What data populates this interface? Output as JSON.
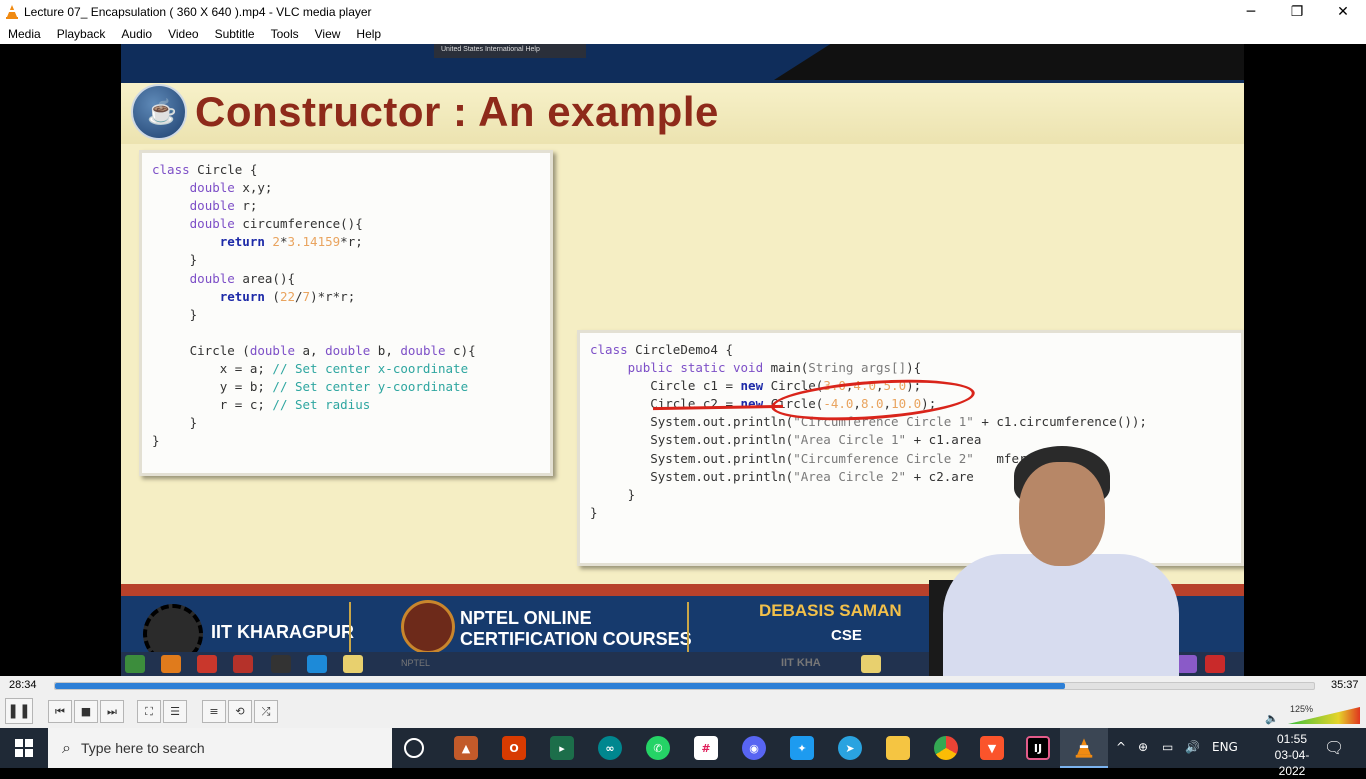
{
  "window": {
    "title": "Lecture 07_ Encapsulation ( 360 X 640 ).mp4 - VLC media player",
    "minimize_icon": "minimize-icon",
    "maximize_icon": "restore-icon",
    "close_icon": "close-icon"
  },
  "menu": [
    "Media",
    "Playback",
    "Audio",
    "Video",
    "Subtitle",
    "Tools",
    "View",
    "Help"
  ],
  "slide": {
    "title": "Constructor : An example",
    "top_tab_text": "United States International  Help",
    "code_left": [
      "class Circle {",
      "     double x,y;",
      "     double r;",
      "     double circumference(){",
      "         return 2*3.14159*r;",
      "     }",
      "     double area(){",
      "         return (22/7)*r*r;",
      "     }",
      "",
      "     Circle (double a, double b, double c){",
      "         x = a; // Set center x-coordinate",
      "         y = b; // Set center y-coordinate",
      "         r = c; // Set radius",
      "     }",
      "}"
    ],
    "code_right": [
      "class CircleDemo4 {",
      "     public static void main(String args[]){",
      "        Circle c1 = new Circle(3.0,4.0,5.0);",
      "        Circle c2 = new Circle(-4.0,8.0,10.0);",
      "        System.out.println(\"Circumference Circle 1\" + c1.circumference());",
      "        System.out.println(\"Area Circle 1\" + c1.area",
      "        System.out.println(\"Circumference Circle 2\"   mference());",
      "        System.out.println(\"Area Circle 2\" + c2.are",
      "     }",
      "}"
    ],
    "footer": {
      "institute": "IIT KHARAGPUR",
      "nptel_line1": "NPTEL ONLINE",
      "nptel_line2": "CERTIFICATION COURSES",
      "presenter": "DEBASIS SAMAN",
      "dept": "CSE",
      "nptel_small": "NPTEL",
      "iit_small": "IIT KHA"
    }
  },
  "player": {
    "elapsed": "28:34",
    "total": "35:37",
    "progress_fraction": 0.802,
    "volume_label": "125%",
    "volume_fraction": 1.0,
    "buttons": [
      "pause-icon",
      "previous-icon",
      "stop-icon",
      "next-icon",
      "fullscreen-icon",
      "extended-settings-icon",
      "playlist-icon",
      "loop-icon",
      "shuffle-icon"
    ]
  },
  "taskbar": {
    "search_placeholder": "Type here to search",
    "apps": [
      "cortana-icon",
      "matlab-icon",
      "office-icon",
      "pycharm-icon",
      "arduino-icon",
      "whatsapp-icon",
      "slack-icon",
      "discord-icon",
      "twitter-icon",
      "telegram-icon",
      "file-explorer-icon",
      "chrome-icon",
      "brave-icon",
      "intellij-icon",
      "vlc-icon"
    ],
    "language": "ENG",
    "time": "01:55",
    "date": "03-04-2022"
  },
  "colors": {
    "accent_blue": "#2d7fd6",
    "slide_title": "#8e2a1a",
    "annotation_red": "#d9241a"
  }
}
